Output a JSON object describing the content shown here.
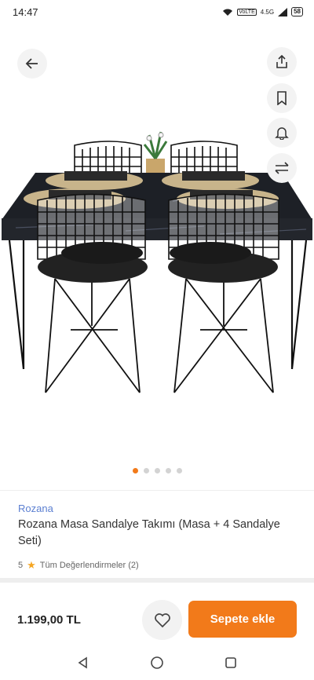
{
  "status_bar": {
    "time": "14:47",
    "network": "4.5G",
    "battery": "58",
    "icons": [
      "wifi-icon",
      "volte-icon",
      "signal-icon",
      "battery-icon"
    ]
  },
  "hero": {
    "actions": [
      {
        "name": "back-icon"
      },
      {
        "name": "share-icon"
      },
      {
        "name": "bookmark-icon"
      },
      {
        "name": "bell-icon"
      },
      {
        "name": "compare-icon"
      }
    ],
    "gallery": {
      "total": 5,
      "active": 1
    }
  },
  "product": {
    "brand": "Rozana",
    "title": "Rozana Masa Sandalye Takımı (Masa + 4 Sandalye Seti)",
    "rating_value": "5",
    "reviews_label": "Tüm Değerlendirmeler (2)"
  },
  "purchase": {
    "price": "1.199,00 TL",
    "add_to_cart_label": "Sepete ekle"
  },
  "colors": {
    "accent": "#f27a1a",
    "brand_link": "#5b7fd1",
    "star": "#f5a623"
  }
}
